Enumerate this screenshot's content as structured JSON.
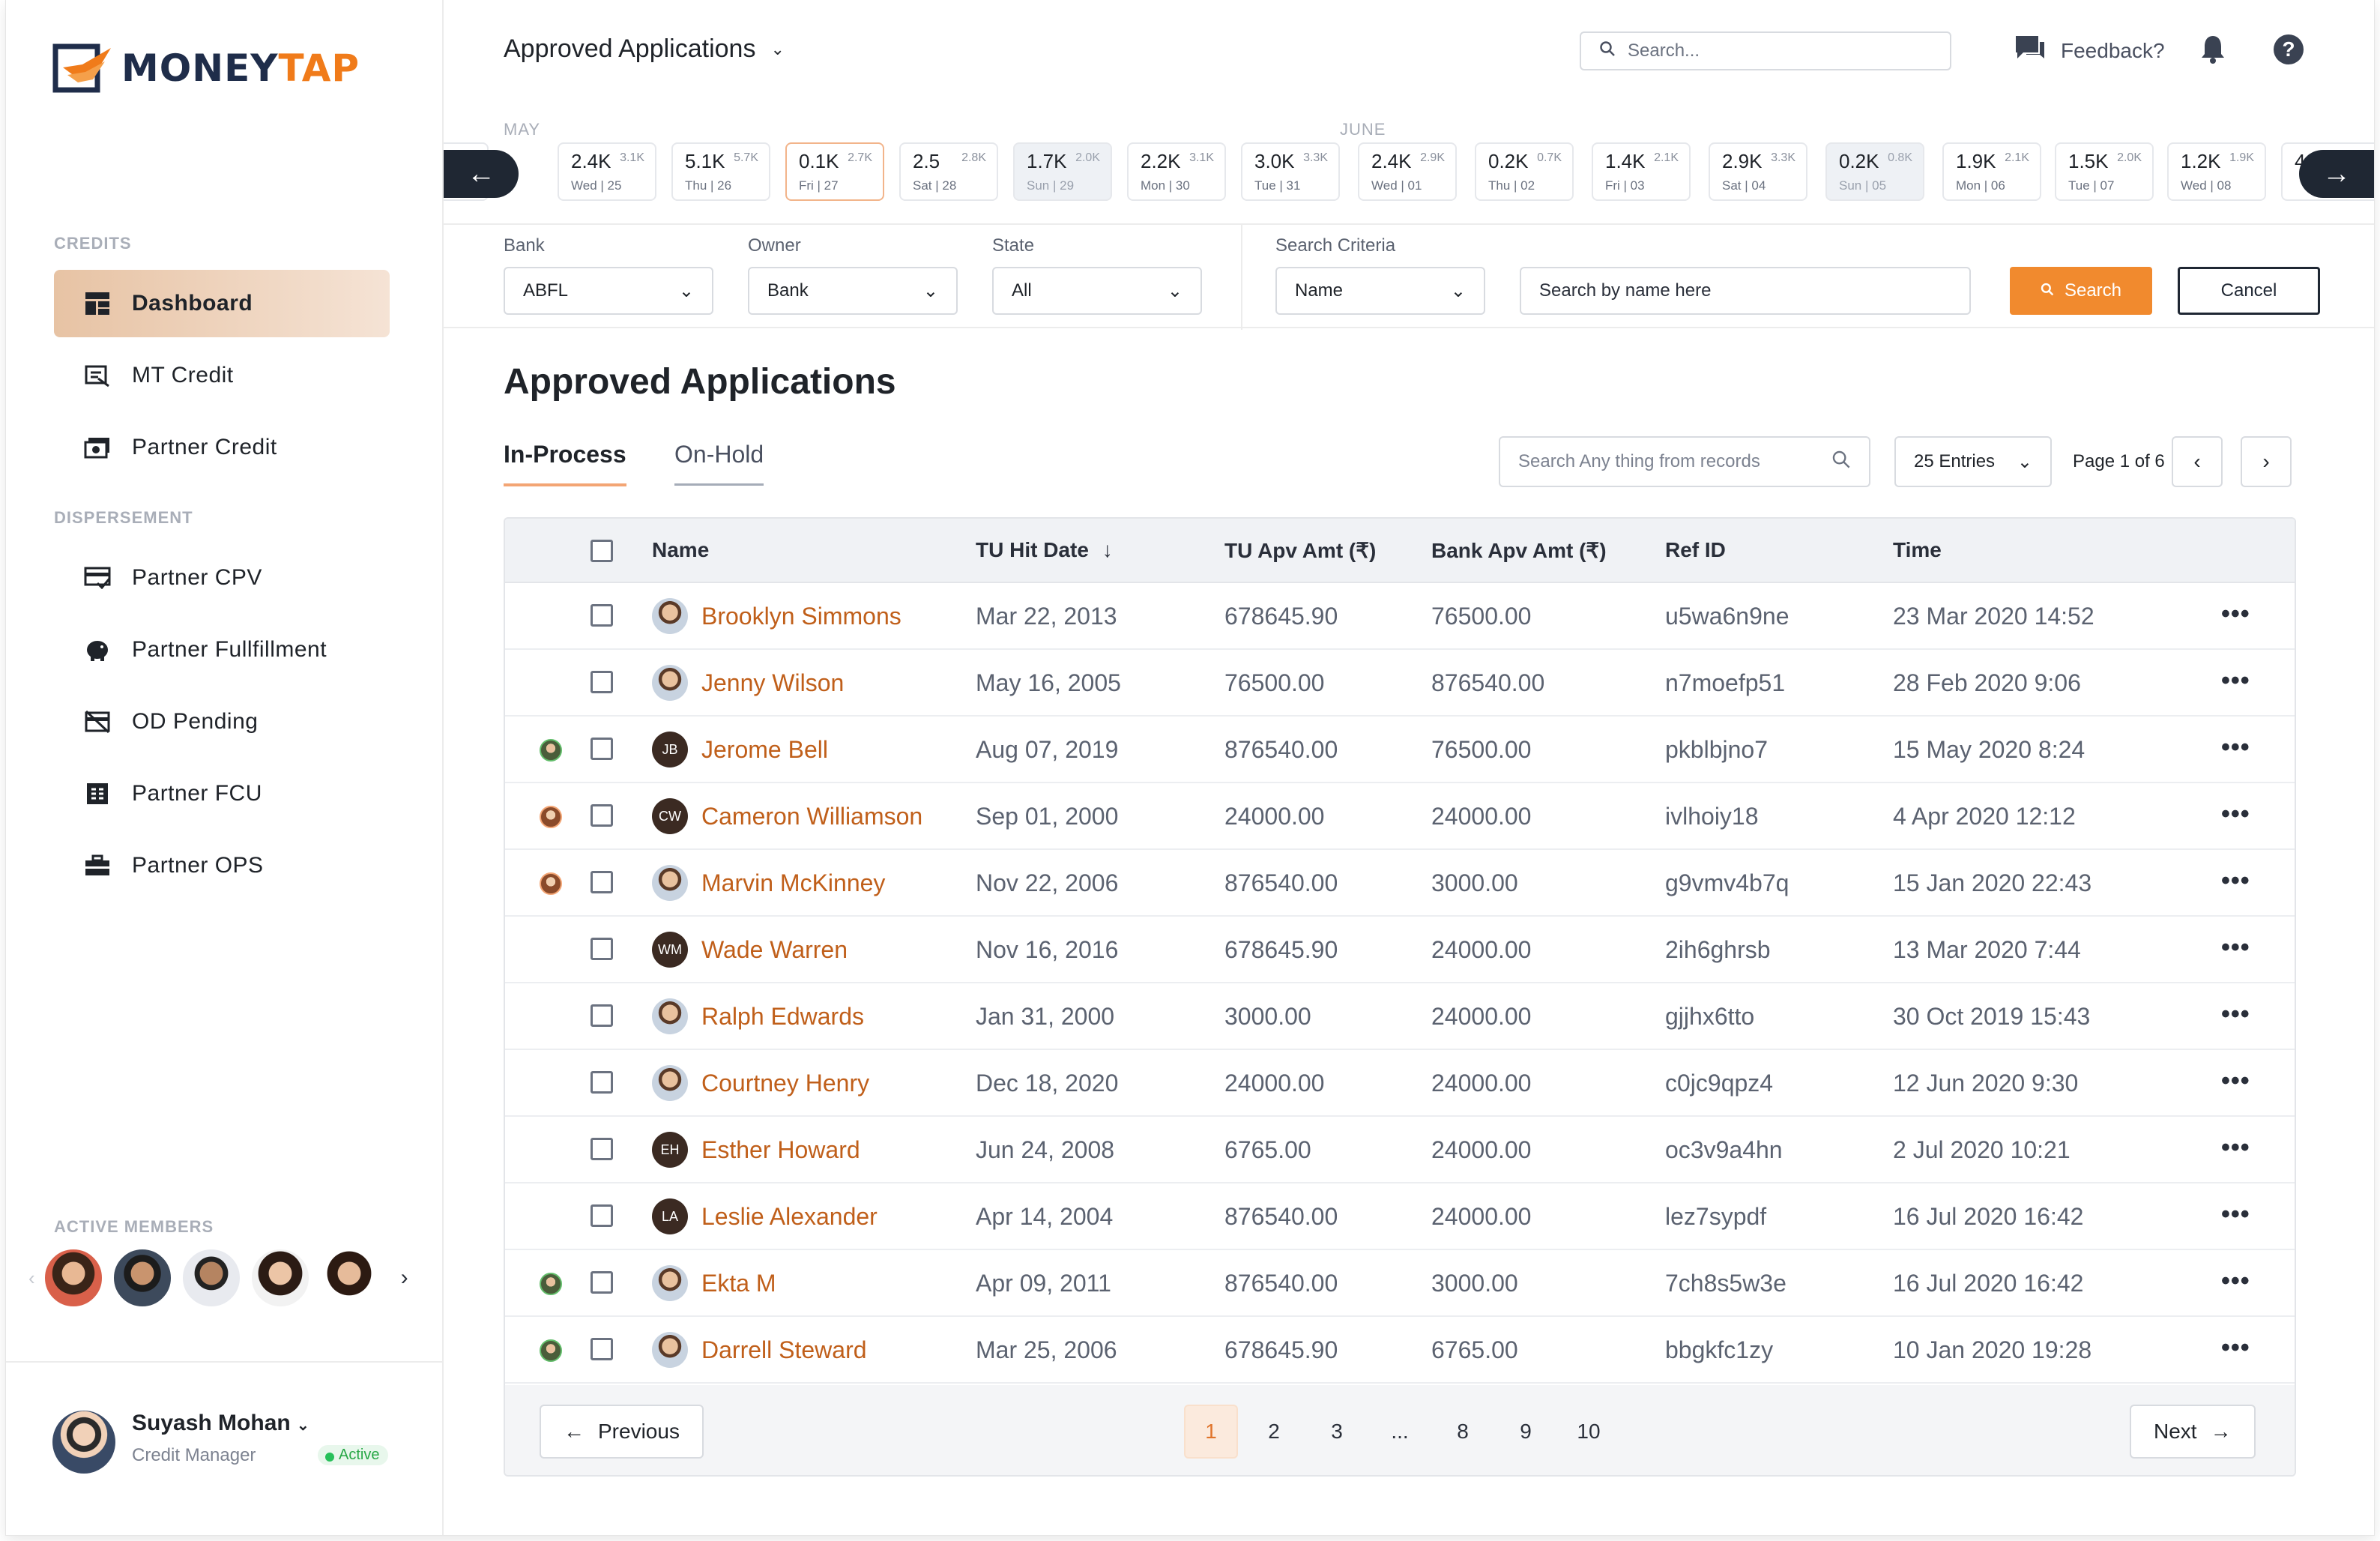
{
  "brand": {
    "part1": "MONEY",
    "part2": "TAP"
  },
  "sidebar": {
    "section_credits": "CREDITS",
    "section_dispersement": "DISPERSEMENT",
    "section_members": "ACTIVE MEMBERS",
    "items": [
      {
        "label": "Dashboard",
        "icon": "dashboard-icon"
      },
      {
        "label": "MT Credit",
        "icon": "credit-card-icon"
      },
      {
        "label": "Partner Credit",
        "icon": "money-icon"
      },
      {
        "label": "Partner CPV",
        "icon": "payment-icon"
      },
      {
        "label": "Partner Fullfillment",
        "icon": "piggy-bank-icon"
      },
      {
        "label": "OD Pending",
        "icon": "card-off-icon"
      },
      {
        "label": "Partner FCU",
        "icon": "document-icon"
      },
      {
        "label": "Partner OPS",
        "icon": "briefcase-icon"
      }
    ],
    "user": {
      "name": "Suyash Mohan",
      "role": "Credit Manager",
      "status": "Active"
    }
  },
  "header": {
    "title": "Approved Applications",
    "search_placeholder": "Search...",
    "feedback": "Feedback?",
    "help": "?"
  },
  "date_strip": {
    "month1": "MAY",
    "month2": "JUNE",
    "days": [
      {
        "value": "2.4K",
        "total": "3.1K",
        "date": "Wed | 25",
        "weekend": false
      },
      {
        "value": "5.1K",
        "total": "5.7K",
        "date": "Thu | 26",
        "weekend": false
      },
      {
        "value": "0.1K",
        "total": "2.7K",
        "date": "Fri | 27",
        "weekend": false,
        "selected": true
      },
      {
        "value": "2.5",
        "total": "2.8K",
        "date": "Sat | 28",
        "weekend": false
      },
      {
        "value": "1.7K",
        "total": "2.0K",
        "date": "Sun | 29",
        "weekend": true
      },
      {
        "value": "2.2K",
        "total": "3.1K",
        "date": "Mon | 30",
        "weekend": false
      },
      {
        "value": "3.0K",
        "total": "3.3K",
        "date": "Tue | 31",
        "weekend": false
      },
      {
        "value": "2.4K",
        "total": "2.9K",
        "date": "Wed | 01",
        "weekend": false
      },
      {
        "value": "0.2K",
        "total": "0.7K",
        "date": "Thu | 02",
        "weekend": false
      },
      {
        "value": "1.4K",
        "total": "2.1K",
        "date": "Fri | 03",
        "weekend": false
      },
      {
        "value": "2.9K",
        "total": "3.3K",
        "date": "Sat | 04",
        "weekend": false
      },
      {
        "value": "0.2K",
        "total": "0.8K",
        "date": "Sun | 05",
        "weekend": true
      },
      {
        "value": "1.9K",
        "total": "2.1K",
        "date": "Mon | 06",
        "weekend": false
      },
      {
        "value": "1.5K",
        "total": "2.0K",
        "date": "Tue | 07",
        "weekend": false
      },
      {
        "value": "1.2K",
        "total": "1.9K",
        "date": "Wed | 08",
        "weekend": false
      }
    ]
  },
  "filters": {
    "bank_label": "Bank",
    "bank_value": "ABFL",
    "owner_label": "Owner",
    "owner_value": "Bank",
    "state_label": "State",
    "state_value": "All",
    "criteria_label": "Search Criteria",
    "criteria_value": "Name",
    "name_placeholder": "Search by name here",
    "search_btn": "Search",
    "cancel_btn": "Cancel"
  },
  "main": {
    "title": "Approved Applications",
    "tabs": [
      "In-Process",
      "On-Hold"
    ],
    "records_search_placeholder": "Search Any thing from records",
    "entries": "25 Entries",
    "page_info": "Page 1 of 6"
  },
  "table": {
    "headers": [
      "Name",
      "TU Hit Date",
      "TU Apv Amt (₹)",
      "Bank Apv Amt (₹)",
      "Ref ID",
      "Time"
    ],
    "rows": [
      {
        "name": "Brooklyn Simmons",
        "date": "Mar 22, 2013",
        "tu": "678645.90",
        "bank": "76500.00",
        "ref": "u5wa6n9ne",
        "time": "23 Mar 2020 14:52",
        "initials": "",
        "mini": ""
      },
      {
        "name": "Jenny Wilson",
        "date": "May 16, 2005",
        "tu": "76500.00",
        "bank": "876540.00",
        "ref": "n7moefp51",
        "time": "28 Feb 2020 9:06",
        "initials": "",
        "mini": ""
      },
      {
        "name": "Jerome Bell",
        "date": "Aug 07, 2019",
        "tu": "876540.00",
        "bank": "76500.00",
        "ref": "pkblbjno7",
        "time": "15 May 2020 8:24",
        "initials": "JB",
        "mini": "g"
      },
      {
        "name": "Cameron Williamson",
        "date": "Sep 01, 2000",
        "tu": "24000.00",
        "bank": "24000.00",
        "ref": "ivlhoiy18",
        "time": "4 Apr 2020 12:12",
        "initials": "CW",
        "mini": "o"
      },
      {
        "name": "Marvin McKinney",
        "date": "Nov 22, 2006",
        "tu": "876540.00",
        "bank": "3000.00",
        "ref": "g9vmv4b7q",
        "time": "15 Jan 2020 22:43",
        "initials": "",
        "mini": "o"
      },
      {
        "name": "Wade Warren",
        "date": "Nov 16, 2016",
        "tu": "678645.90",
        "bank": "24000.00",
        "ref": "2ih6ghrsb",
        "time": "13 Mar 2020 7:44",
        "initials": "WM",
        "mini": ""
      },
      {
        "name": "Ralph Edwards",
        "date": "Jan 31, 2000",
        "tu": "3000.00",
        "bank": "24000.00",
        "ref": "gjjhx6tto",
        "time": "30 Oct 2019 15:43",
        "initials": "",
        "mini": ""
      },
      {
        "name": "Courtney Henry",
        "date": "Dec 18, 2020",
        "tu": "24000.00",
        "bank": "24000.00",
        "ref": "c0jc9qpz4",
        "time": "12 Jun 2020 9:30",
        "initials": "",
        "mini": ""
      },
      {
        "name": "Esther Howard",
        "date": "Jun 24, 2008",
        "tu": "6765.00",
        "bank": "24000.00",
        "ref": "oc3v9a4hn",
        "time": "2 Jul 2020 10:21",
        "initials": "EH",
        "mini": ""
      },
      {
        "name": "Leslie Alexander",
        "date": "Apr 14, 2004",
        "tu": "876540.00",
        "bank": "24000.00",
        "ref": "lez7sypdf",
        "time": "16 Jul 2020 16:42",
        "initials": "LA",
        "mini": ""
      },
      {
        "name": "Ekta M",
        "date": "Apr 09, 2011",
        "tu": "876540.00",
        "bank": "3000.00",
        "ref": "7ch8s5w3e",
        "time": "16 Jul 2020 16:42",
        "initials": "",
        "mini": "g"
      },
      {
        "name": "Darrell Steward",
        "date": "Mar 25, 2006",
        "tu": "678645.90",
        "bank": "6765.00",
        "ref": "bbgkfc1zy",
        "time": "10 Jan 2020 19:28",
        "initials": "",
        "mini": "g"
      }
    ]
  },
  "pagination": {
    "prev": "Previous",
    "next": "Next",
    "pages": [
      "1",
      "2",
      "3",
      "...",
      "8",
      "9",
      "10"
    ]
  },
  "colors": {
    "accent": "#f18a2e",
    "link": "#c05f1a",
    "brand_navy": "#1f2d4a"
  }
}
